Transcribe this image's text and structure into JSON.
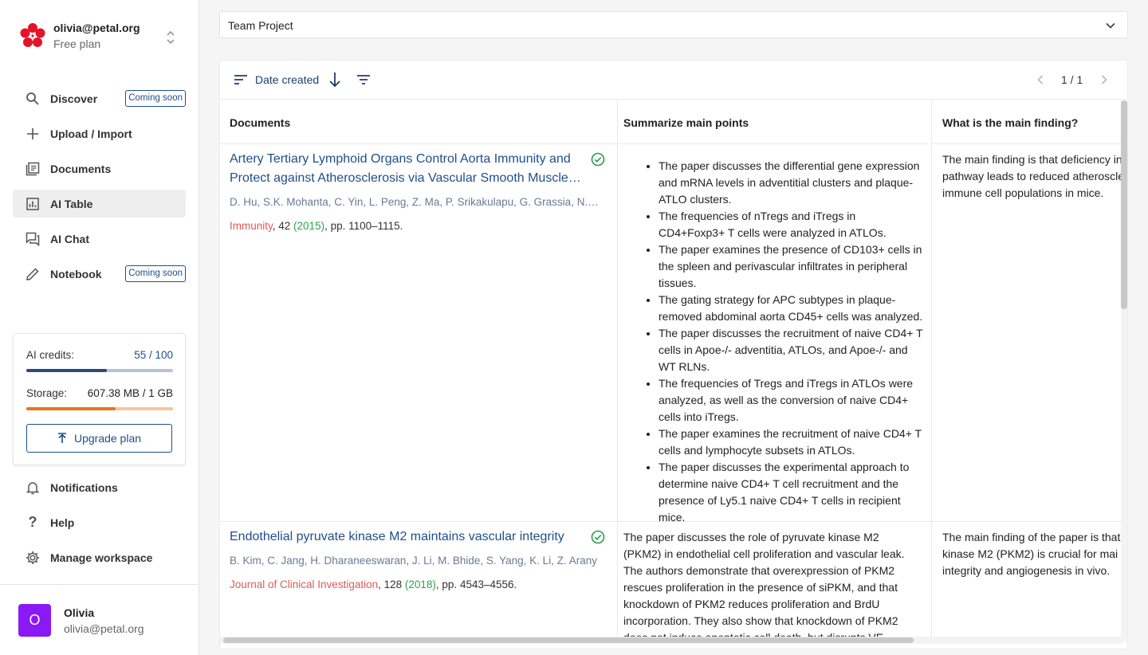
{
  "workspace": {
    "email": "olivia@petal.org",
    "plan": "Free plan"
  },
  "nav": {
    "discover": {
      "label": "Discover",
      "badge": "Coming soon"
    },
    "upload": {
      "label": "Upload / Import"
    },
    "documents": {
      "label": "Documents"
    },
    "ai_table": {
      "label": "AI Table"
    },
    "ai_chat": {
      "label": "AI Chat"
    },
    "notebook": {
      "label": "Notebook",
      "badge": "Coming soon"
    }
  },
  "usage": {
    "credits_label": "AI credits:",
    "credits_value": "55 / 100",
    "credits_fraction": 0.55,
    "storage_label": "Storage:",
    "storage_value": "607.38 MB / 1 GB",
    "storage_fraction": 0.607,
    "upgrade_label": "Upgrade plan"
  },
  "bottom_nav": {
    "notifications": "Notifications",
    "help": "Help",
    "manage": "Manage workspace"
  },
  "user": {
    "initial": "O",
    "name": "Olivia",
    "email": "olivia@petal.org"
  },
  "project": {
    "selected": "Team Project"
  },
  "toolbar": {
    "sort_label": "Date created",
    "pager": "1 / 1"
  },
  "columns": [
    "Documents",
    "Summarize main points",
    "What is the main finding?"
  ],
  "rows": [
    {
      "title": "Artery Tertiary Lymphoid Organs Control Aorta Immunity and Protect against Atherosclerosis via Vascular Smooth Muscle Cell Lymphotoxin β Receptors",
      "authors": "D. Hu, S.K. Mohanta, C. Yin, L. Peng, Z. Ma, P. Srikakulapu, G. Grassia, N. MacRitchie",
      "journal": "Immunity",
      "volume": ", 42 ",
      "year": "(2015)",
      "pages": ", pp. 1100–1115.",
      "summary_points": [
        "The paper discusses the differential gene expression and mRNA levels in adventitial clusters and plaque-ATLO clusters.",
        "The frequencies of nTregs and iTregs in CD4+Foxp3+ T cells were analyzed in ATLOs.",
        "The paper examines the presence of CD103+ cells in the spleen and perivascular infiltrates in peripheral tissues.",
        "The gating strategy for APC subtypes in plaque-removed abdominal aorta CD45+ cells was analyzed.",
        "The paper discusses the recruitment of naive CD4+ T cells in Apoe-/- adventitia, ATLOs, and Apoe-/- and WT RLNs.",
        "The frequencies of Tregs and iTregs in ATLOs were analyzed, as well as the conversion of naive CD4+ cells into iTregs.",
        "The paper examines the recruitment of naive CD4+ T cells and lymphocyte subsets in ATLOs.",
        "The paper discusses the experimental approach to determine naive CD4+ T cell recruitment and the presence of Ly5.1 naive CD4+ T cells in recipient mice."
      ],
      "finding": "The main finding is that deficiency in pathway leads to reduced atheroscle immune cell populations in mice."
    },
    {
      "title": "Endothelial pyruvate kinase M2 maintains vascular integrity",
      "authors": "B. Kim, C. Jang, H. Dharaneeswaran, J. Li, M. Bhide, S. Yang, K. Li, Z. Arany",
      "journal": "Journal of Clinical Investigation",
      "volume": ", 128 ",
      "year": "(2018)",
      "pages": ", pp. 4543–4556.",
      "summary_text": "The paper discusses the role of pyruvate kinase M2 (PKM2) in endothelial cell proliferation and vascular leak. The authors demonstrate that overexpression of PKM2 rescues proliferation in the presence of siPKM, and that knockdown of PKM2 reduces proliferation and BrdU incorporation. They also show that knockdown of PKM2 does not induce apoptotic cell death, but disrupts VE-",
      "finding": "The main finding of the paper is that kinase M2 (PKM2) is crucial for mai integrity and angiogenesis in vivo."
    }
  ],
  "colors": {
    "accent": "#1f4e8c",
    "avatar": "#8a19f5",
    "storage": "#e8741a",
    "journal": "#e05a5a",
    "year": "#2aa24a",
    "check": "#2a9a4a"
  }
}
